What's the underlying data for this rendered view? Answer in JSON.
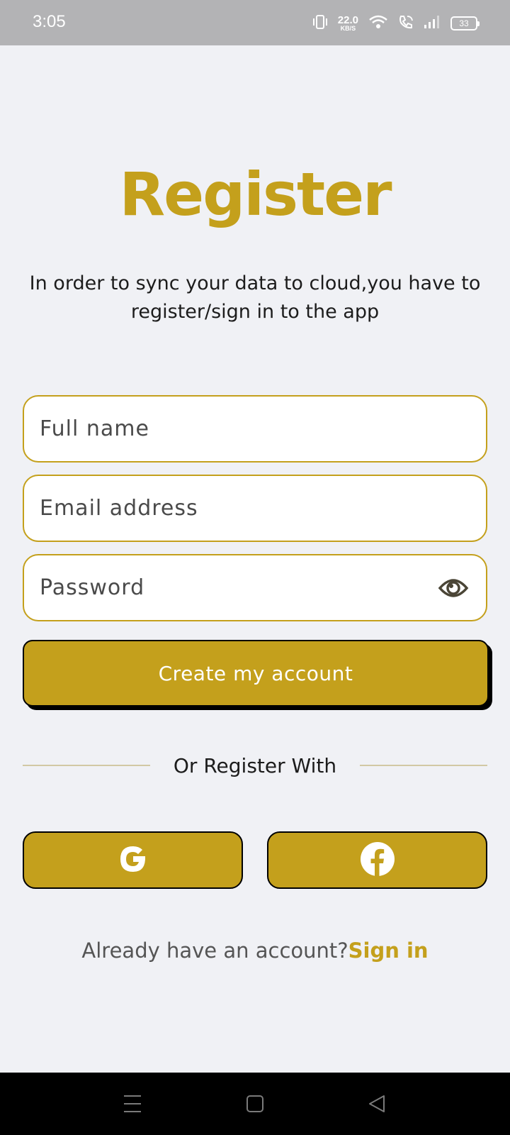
{
  "status_bar": {
    "time": "3:05",
    "speed_value": "22.0",
    "speed_unit": "KB/S",
    "battery": "33",
    "icons": [
      "vibrate-icon",
      "wifi-icon",
      "wifi-calling-icon",
      "signal-icon",
      "battery-icon"
    ]
  },
  "page": {
    "title": "Register",
    "subtitle": "In order to sync your data to cloud,you have to register/sign in to the app"
  },
  "form": {
    "full_name_placeholder": "Full name",
    "email_placeholder": "Email address",
    "password_placeholder": "Password",
    "full_name_value": "",
    "email_value": "",
    "password_value": "",
    "submit_label": "Create my account"
  },
  "social": {
    "divider_label": "Or Register With",
    "providers": [
      "google-icon",
      "facebook-icon"
    ]
  },
  "footer": {
    "prompt": "Already have an account?",
    "link": "Sign in"
  },
  "nav": {
    "buttons": [
      "menu-icon",
      "home-icon",
      "back-icon"
    ]
  },
  "colors": {
    "accent": "#c4a01c",
    "background": "#f0f1f5",
    "status_bar": "#b3b3b5",
    "nav_bar": "#000000"
  }
}
